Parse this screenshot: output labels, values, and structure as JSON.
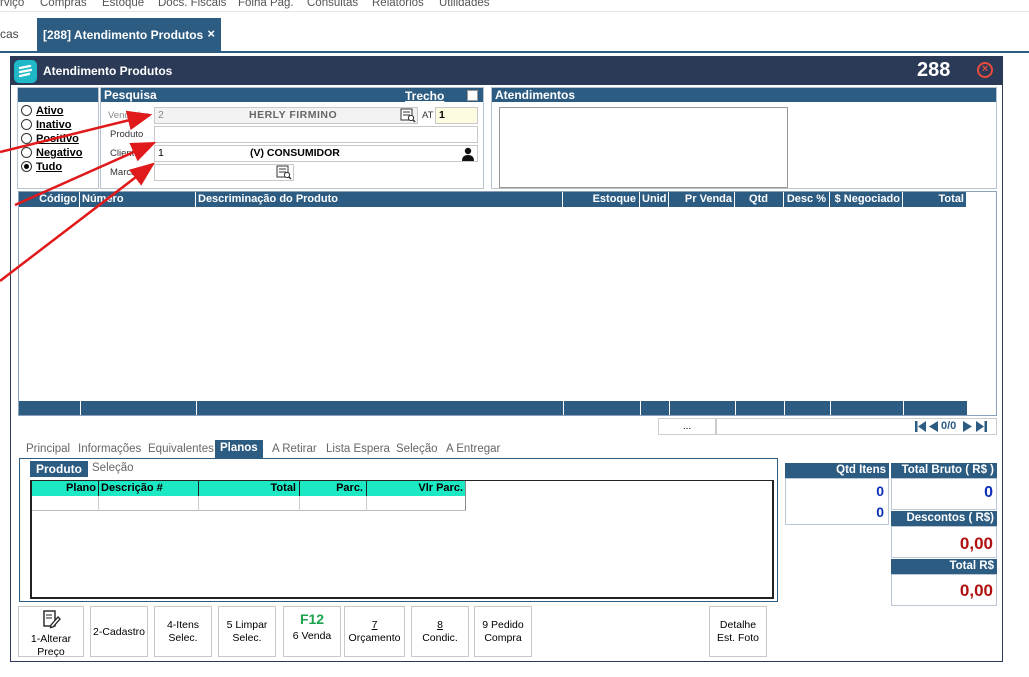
{
  "menu": [
    "rviço",
    "Compras",
    "Estoque",
    "Docs. Fiscais",
    "Folha Pag.",
    "Consultas",
    "Relatórios",
    "Utilidades"
  ],
  "tabs": {
    "prev_label": "cas",
    "active_label": "[288] Atendimento Produtos",
    "close": "×"
  },
  "window": {
    "title": "Atendimento Produtos",
    "number": "288",
    "close": "×"
  },
  "status": {
    "items": [
      "Ativo",
      "Inativo",
      "Positivo",
      "Negativo",
      "Tudo"
    ],
    "selected": "Tudo"
  },
  "pesquisa": {
    "header": "Pesquisa",
    "trecho_label": "Trecho",
    "vendedor_label": "Vendedor",
    "vendedor_code": "2",
    "vendedor_name": "HERLY FIRMINO",
    "at_label": "AT",
    "at_value": "1",
    "produto_label": "Produto",
    "produto_value": "",
    "cliente_label": "Cliente",
    "cliente_code": "1",
    "cliente_name": "(V) CONSUMIDOR",
    "marca_label": "Marca",
    "marca_value": ""
  },
  "atendimentos": {
    "header": "Atendimentos"
  },
  "grid": {
    "columns": [
      "Código",
      "Número",
      "Descriminação do Produto",
      "Estoque",
      "Unid",
      "Pr Venda",
      "Qtd",
      "Desc %",
      "$ Negociado",
      "Total"
    ],
    "rows": []
  },
  "pager": {
    "ellipsis": "...",
    "page": "0/0"
  },
  "subtabs": [
    "Principal",
    "Informações",
    "Equivalentes",
    "Planos",
    "A Retirar",
    "Lista Espera",
    "Seleção",
    "A Entregar"
  ],
  "subtab_active": "Planos",
  "planos": {
    "tabs": [
      "Produto",
      "Seleção"
    ],
    "columns": [
      "Plano",
      "Descrição #",
      "Total",
      "Parc.",
      "Vlr Parc."
    ],
    "rows": []
  },
  "totals": {
    "qtd_itens_label": "Qtd Itens",
    "qtd_itens_1": "0",
    "qtd_itens_2": "0",
    "total_bruto_label": "Total Bruto ( R$ )",
    "total_bruto_value": "0",
    "descontos_label": "Descontos ( R$)",
    "descontos_value": "0,00",
    "total_label": "Total R$",
    "total_value": "0,00"
  },
  "buttons": {
    "alterar_preco": [
      "1-Alterar",
      "Preço"
    ],
    "cadastro": "2-Cadastro",
    "itens_selec": [
      "4-Itens",
      "Selec."
    ],
    "limpar_selec": [
      "5 Limpar",
      "Selec."
    ],
    "venda_key": "F12",
    "venda": "6 Venda",
    "orcamento_key": "7",
    "orcamento": "Orçamento",
    "condic_key": "8",
    "condic": "Condic.",
    "pedido_compra": [
      "9 Pedido",
      "Compra"
    ],
    "detalhe_foto": [
      "Detalhe",
      "Est. Foto"
    ]
  },
  "colors": {
    "header_blue": "#2d5c83",
    "title_bar": "#2b3b57",
    "grid_header_teal": "#1de8c4",
    "money_red": "#b01010",
    "qty_blue": "#0b2fb8",
    "arrow_red": "#e0191b"
  }
}
